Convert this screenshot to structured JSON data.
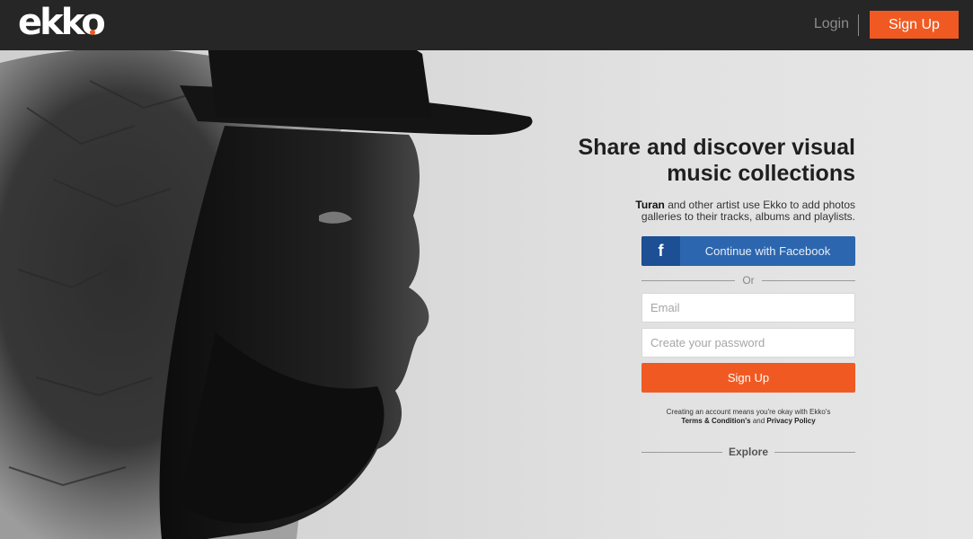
{
  "brand": {
    "name": "ekko",
    "accent_color": "#f05a22",
    "header_color": "#262626"
  },
  "header": {
    "login_label": "Login",
    "signup_label": "Sign Up"
  },
  "hero": {
    "image_icon": "portrait-illustration"
  },
  "signup_panel": {
    "headline_line1": "Share and discover visual",
    "headline_line2": "music collections",
    "sub_artist": "Turan",
    "sub_text_1": " and other artist use Ekko to add photos",
    "sub_text_2": "galleries to their tracks, albums and playlists.",
    "facebook_icon": "f",
    "facebook_label": "Continue with Facebook",
    "facebook_color": "#2c66ae",
    "or_label": "Or",
    "email_placeholder": "Email",
    "password_placeholder": "Create your password",
    "signup_label": "Sign Up",
    "terms_prefix": "Creating an account means you're okay with Ekko's",
    "terms_link": "Terms & Condition's",
    "terms_and": " and ",
    "privacy_link": "Privacy Policy",
    "explore_label": "Explore"
  }
}
